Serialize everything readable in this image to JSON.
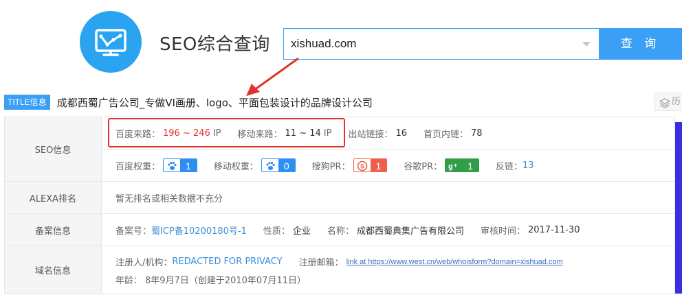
{
  "header": {
    "app_title": "SEO综合查询",
    "logo_icon": "chart-monitor-icon"
  },
  "search": {
    "value": "xishuad.com",
    "placeholder": "",
    "button_label": "查 询"
  },
  "title_row": {
    "badge": "TITLE信息",
    "text": "成都西蜀广告公司_专做VI画册、logo、平面包装设计的品牌设计公司",
    "history_label": "历"
  },
  "seo": {
    "label": "SEO信息",
    "baidu_traffic_key": "百度来路：",
    "baidu_traffic_value": "196 ~ 246",
    "baidu_traffic_unit": "IP",
    "mobile_traffic_key": "移动来路：",
    "mobile_traffic_value": "11 ~ 14",
    "mobile_traffic_unit": "IP",
    "outbound_key": "出站链接：",
    "outbound_value": "16",
    "internal_key": "首页内链：",
    "internal_value": "78",
    "baidu_weight_key": "百度权重：",
    "baidu_weight_value": "1",
    "mobile_weight_key": "移动权重：",
    "mobile_weight_value": "0",
    "sogou_pr_key": "搜狗PR：",
    "sogou_pr_value": "1",
    "google_pr_key": "谷歌PR：",
    "google_pr_value": "1",
    "backlinks_key": "反链：",
    "backlinks_value": "13"
  },
  "alexa": {
    "label": "ALEXA排名",
    "text": "暂无排名或相关数据不充分"
  },
  "icp": {
    "label": "备案信息",
    "number_key": "备案号：",
    "number_value": "蜀ICP备10200180号-1",
    "nature_key": "性质：",
    "nature_value": "企业",
    "name_key": "名称：",
    "name_value": "成都西蜀典集广告有限公司",
    "review_key": "审核时间：",
    "review_value": "2017-11-30"
  },
  "domain": {
    "label": "域名信息",
    "registrant_key": "注册人/机构：",
    "registrant_value": "REDACTED FOR PRIVACY",
    "email_key": "注册邮箱：",
    "email_value": "link at https://www.west.cn/web/whoisform?domain=xishuad.com",
    "age_key": "年龄：",
    "age_value": "8年9月7日（创建于2010年07月11日）"
  },
  "colors": {
    "accent": "#3a9ff5",
    "highlight_red": "#e0332b",
    "baidu_blue": "#2d8ff0",
    "sogou_red": "#ee5e48",
    "google_green": "#2f9e47"
  }
}
